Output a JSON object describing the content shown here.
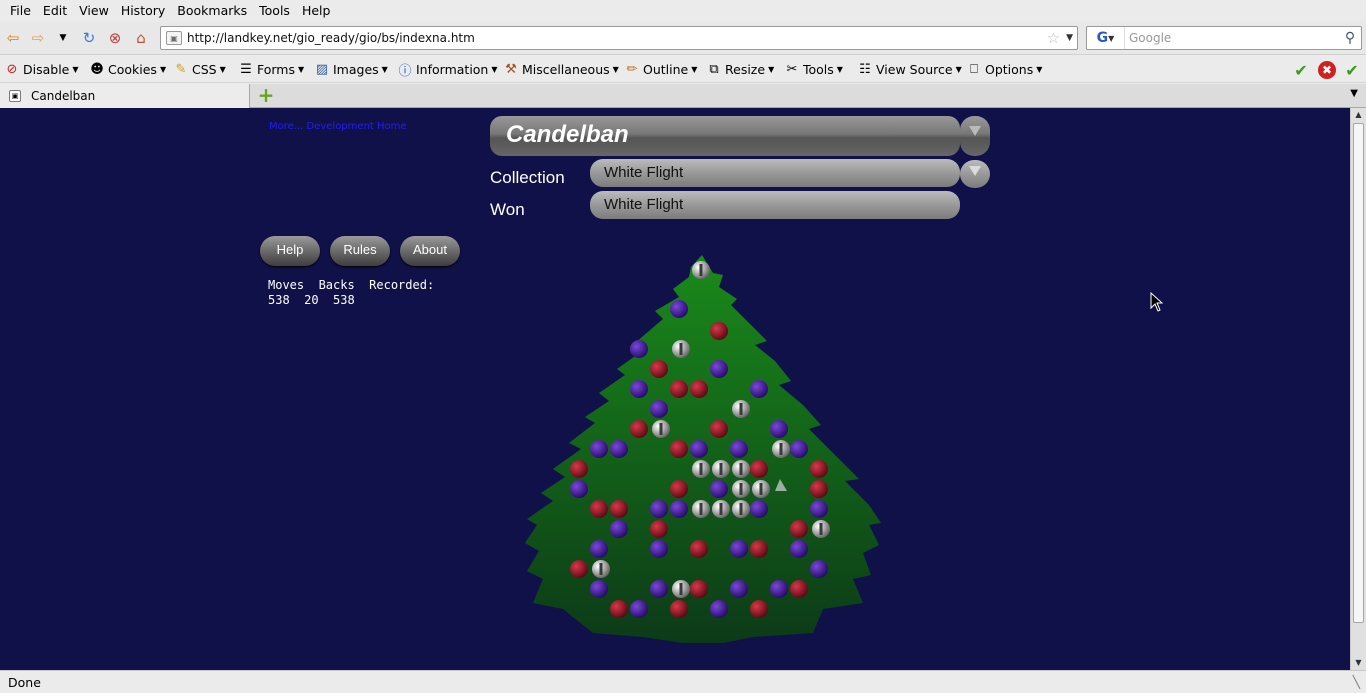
{
  "menu": [
    "File",
    "Edit",
    "View",
    "History",
    "Bookmarks",
    "Tools",
    "Help"
  ],
  "nav": {
    "url": "http://landkey.net/gio_ready/gio/bs/indexna.htm",
    "search_placeholder": "Google"
  },
  "webdev": {
    "items": [
      "Disable",
      "Cookies",
      "CSS",
      "Forms",
      "Images",
      "Information",
      "Miscellaneous",
      "Outline",
      "Resize",
      "Tools",
      "View Source",
      "Options"
    ]
  },
  "tab": {
    "title": "Candelban"
  },
  "status": {
    "text": "Done"
  },
  "page": {
    "dev_link": "More... Development Home",
    "title": "Candelban",
    "collection_label": "Collection",
    "collection_value": "White Flight",
    "won_label": "Won",
    "won_value": "White Flight",
    "buttons": {
      "help": "Help",
      "rules": "Rules",
      "about": "About"
    },
    "stats_header": "Moves  Backs  Recorded:",
    "stats_values": "538  20  538"
  },
  "colors": {
    "page_bg": "#11114a",
    "tree": "#1c7a1c",
    "ball_red": "#9a1024",
    "ball_purple": "#4a1aa0",
    "ball_white": "#d0d0d0"
  }
}
